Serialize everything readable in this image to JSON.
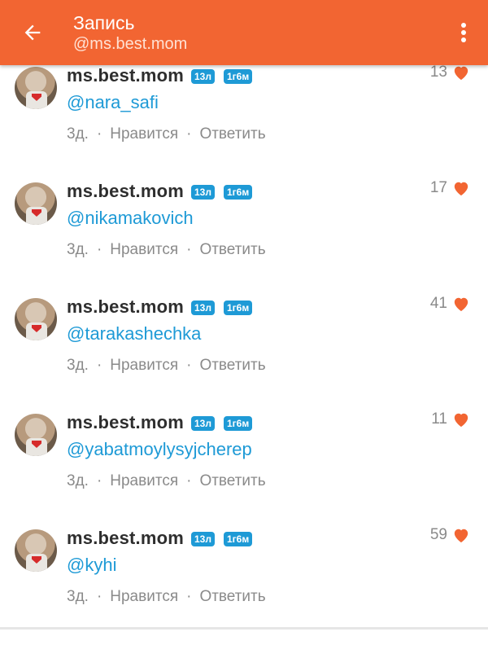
{
  "header": {
    "title": "Запись",
    "subtitle": "@ms.best.mom",
    "back_icon": "arrow-left-icon",
    "menu_icon": "more-vertical-icon",
    "bar_color": "#f26532"
  },
  "comments": [
    {
      "username": "ms.best.mom",
      "age_badge": "13л",
      "tenure_badge": "1г6м",
      "text": "@nara_safi",
      "time": "3д.",
      "like_label": "Нравится",
      "reply_label": "Ответить",
      "likes": "13"
    },
    {
      "username": "ms.best.mom",
      "age_badge": "13л",
      "tenure_badge": "1г6м",
      "text": "@nikamakovich",
      "time": "3д.",
      "like_label": "Нравится",
      "reply_label": "Ответить",
      "likes": "17"
    },
    {
      "username": "ms.best.mom",
      "age_badge": "13л",
      "tenure_badge": "1г6м",
      "text": "@tarakashechka",
      "time": "3д.",
      "like_label": "Нравится",
      "reply_label": "Ответить",
      "likes": "41"
    },
    {
      "username": "ms.best.mom",
      "age_badge": "13л",
      "tenure_badge": "1г6м",
      "text": "@yabatmoylysyjcherep",
      "time": "3д.",
      "like_label": "Нравится",
      "reply_label": "Ответить",
      "likes": "11"
    },
    {
      "username": "ms.best.mom",
      "age_badge": "13л",
      "tenure_badge": "1г6м",
      "text": "@kyhi",
      "time": "3д.",
      "like_label": "Нравится",
      "reply_label": "Ответить",
      "likes": "59"
    }
  ],
  "colors": {
    "accent": "#f26532",
    "link": "#1e9ad6",
    "heart": "#f26532"
  }
}
